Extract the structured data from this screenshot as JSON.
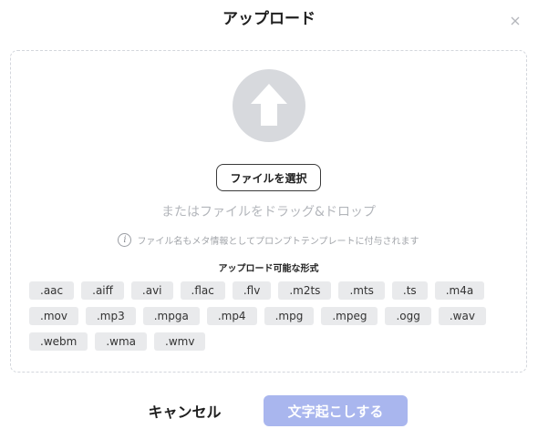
{
  "dialog": {
    "title": "アップロード",
    "close_icon": "close-icon"
  },
  "dropzone": {
    "upload_icon": "arrow-up-icon",
    "select_button_label": "ファイルを選択",
    "drop_text": "またはファイルをドラッグ&ドロップ",
    "info_icon": "info-icon",
    "info_text": "ファイル名もメタ情報としてプロンプトテンプレートに付与されます",
    "formats_title": "アップロード可能な形式",
    "formats": [
      ".aac",
      ".aiff",
      ".avi",
      ".flac",
      ".flv",
      ".m2ts",
      ".mts",
      ".ts",
      ".m4a",
      ".mov",
      ".mp3",
      ".mpga",
      ".mp4",
      ".mpg",
      ".mpeg",
      ".ogg",
      ".wav",
      ".webm",
      ".wma",
      ".wmv"
    ]
  },
  "footer": {
    "cancel_label": "キャンセル",
    "submit_label": "文字起こしする"
  },
  "colors": {
    "submit_disabled": "#a9b6ee",
    "upload_circle": "#d7d9dd",
    "chip_bg": "#e9eaec"
  }
}
